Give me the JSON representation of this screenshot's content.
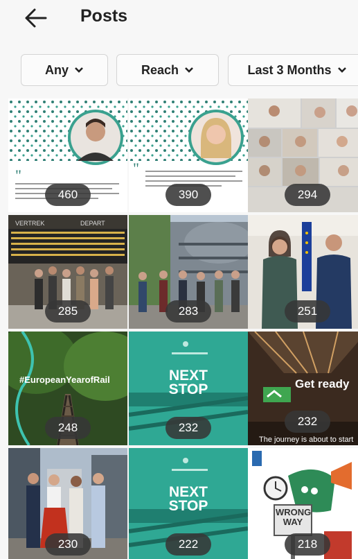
{
  "header": {
    "title": "Posts"
  },
  "filters": [
    {
      "label": "Any"
    },
    {
      "label": "Reach"
    },
    {
      "label": "Last 3 Months"
    }
  ],
  "posts": [
    {
      "count": "460",
      "subject": "quote card with portrait of young man"
    },
    {
      "count": "390",
      "subject": "quote card with portrait of young woman"
    },
    {
      "count": "294",
      "subject": "video call grid"
    },
    {
      "count": "285",
      "subject": "group at train station departure board",
      "sign_left": "VERTREK",
      "sign_right": "DEPART"
    },
    {
      "count": "283",
      "subject": "group outside round glass building"
    },
    {
      "count": "251",
      "subject": "two people in front of EU flag"
    },
    {
      "count": "248",
      "subject": "railway in forest",
      "overlay": "#EuropeanYearofRail"
    },
    {
      "count": "232",
      "subject": "next stop teal graphic",
      "overlay": "NEXT STOP"
    },
    {
      "count": "232",
      "subject": "station platform",
      "overlay": "Get ready",
      "caption": "The journey is about to start"
    },
    {
      "count": "230",
      "subject": "four people in city street"
    },
    {
      "count": "222",
      "subject": "next stop teal graphic",
      "overlay": "NEXT STOP"
    },
    {
      "count": "218",
      "subject": "wrong way cartoon",
      "overlay": "WRONG WAY"
    }
  ],
  "colors": {
    "accent_teal": "#3aa18f",
    "badge": "#373737"
  }
}
